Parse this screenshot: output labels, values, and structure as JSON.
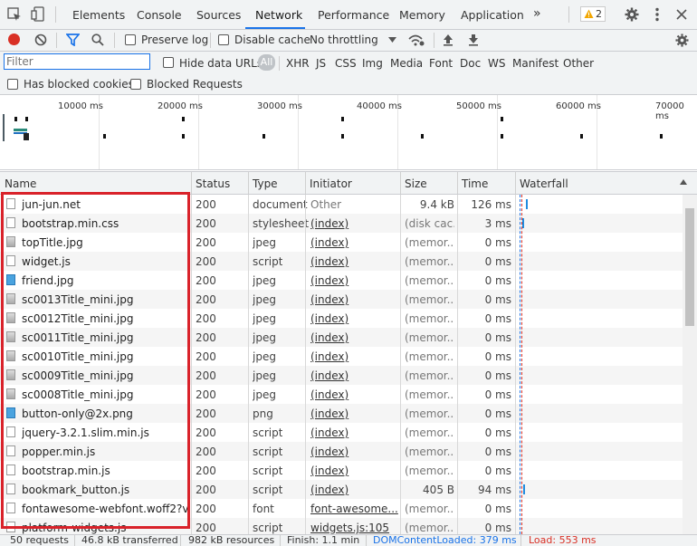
{
  "tabs": [
    "Elements",
    "Console",
    "Sources",
    "Network",
    "Performance",
    "Memory",
    "Application"
  ],
  "more_tabs": "»",
  "warning_count": "2",
  "toolbar": {
    "preserve_log": "Preserve log",
    "disable_cache": "Disable cache",
    "throttling": "No throttling"
  },
  "filter": {
    "placeholder": "Filter",
    "hide_data_urls": "Hide data URLs",
    "types": [
      "All",
      "XHR",
      "JS",
      "CSS",
      "Img",
      "Media",
      "Font",
      "Doc",
      "WS",
      "Manifest",
      "Other"
    ],
    "has_blocked_cookies": "Has blocked cookies",
    "blocked_requests": "Blocked Requests"
  },
  "overview_ticks": [
    "10000 ms",
    "20000 ms",
    "30000 ms",
    "40000 ms",
    "50000 ms",
    "60000 ms",
    "70000 ms"
  ],
  "columns": [
    "Name",
    "Status",
    "Type",
    "Initiator",
    "Size",
    "Time",
    "Waterfall"
  ],
  "rows": [
    {
      "name": "jun-jun.net",
      "status": "200",
      "type": "document",
      "initiator": "Other",
      "size": "9.4 kB",
      "time": "126 ms"
    },
    {
      "name": "bootstrap.min.css",
      "status": "200",
      "type": "stylesheet",
      "initiator": "(index)",
      "size": "(disk cac...",
      "time": "3 ms"
    },
    {
      "name": "topTitle.jpg",
      "status": "200",
      "type": "jpeg",
      "initiator": "(index)",
      "size": "(memor...",
      "time": "0 ms"
    },
    {
      "name": "widget.js",
      "status": "200",
      "type": "script",
      "initiator": "(index)",
      "size": "(memor...",
      "time": "0 ms"
    },
    {
      "name": "friend.jpg",
      "status": "200",
      "type": "jpeg",
      "initiator": "(index)",
      "size": "(memor...",
      "time": "0 ms"
    },
    {
      "name": "sc0013Title_mini.jpg",
      "status": "200",
      "type": "jpeg",
      "initiator": "(index)",
      "size": "(memor...",
      "time": "0 ms"
    },
    {
      "name": "sc0012Title_mini.jpg",
      "status": "200",
      "type": "jpeg",
      "initiator": "(index)",
      "size": "(memor...",
      "time": "0 ms"
    },
    {
      "name": "sc0011Title_mini.jpg",
      "status": "200",
      "type": "jpeg",
      "initiator": "(index)",
      "size": "(memor...",
      "time": "0 ms"
    },
    {
      "name": "sc0010Title_mini.jpg",
      "status": "200",
      "type": "jpeg",
      "initiator": "(index)",
      "size": "(memor...",
      "time": "0 ms"
    },
    {
      "name": "sc0009Title_mini.jpg",
      "status": "200",
      "type": "jpeg",
      "initiator": "(index)",
      "size": "(memor...",
      "time": "0 ms"
    },
    {
      "name": "sc0008Title_mini.jpg",
      "status": "200",
      "type": "jpeg",
      "initiator": "(index)",
      "size": "(memor...",
      "time": "0 ms"
    },
    {
      "name": "button-only@2x.png",
      "status": "200",
      "type": "png",
      "initiator": "(index)",
      "size": "(memor...",
      "time": "0 ms"
    },
    {
      "name": "jquery-3.2.1.slim.min.js",
      "status": "200",
      "type": "script",
      "initiator": "(index)",
      "size": "(memor...",
      "time": "0 ms"
    },
    {
      "name": "popper.min.js",
      "status": "200",
      "type": "script",
      "initiator": "(index)",
      "size": "(memor...",
      "time": "0 ms"
    },
    {
      "name": "bootstrap.min.js",
      "status": "200",
      "type": "script",
      "initiator": "(index)",
      "size": "(memor...",
      "time": "0 ms"
    },
    {
      "name": "bookmark_button.js",
      "status": "200",
      "type": "script",
      "initiator": "(index)",
      "size": "405 B",
      "time": "94 ms"
    },
    {
      "name": "fontawesome-webfont.woff2?v=...",
      "status": "200",
      "type": "font",
      "initiator": "font-awesome...",
      "size": "(memor...",
      "time": "0 ms"
    },
    {
      "name": "platform-widgets.js",
      "status": "200",
      "type": "script",
      "initiator": "widgets.js:105",
      "size": "(memor...",
      "time": "0 ms"
    }
  ],
  "status_bar": {
    "requests": "50 requests",
    "transferred": "46.8 kB transferred",
    "resources": "982 kB resources",
    "finish": "Finish: 1.1 min",
    "dcl": "DOMContentLoaded: 379 ms",
    "load": "Load: 553 ms"
  },
  "colors": {
    "accent": "#1a73e8",
    "record": "#d93025",
    "dcl": "#1a73e8",
    "load": "#d93025",
    "highlight": "#d9222a"
  }
}
